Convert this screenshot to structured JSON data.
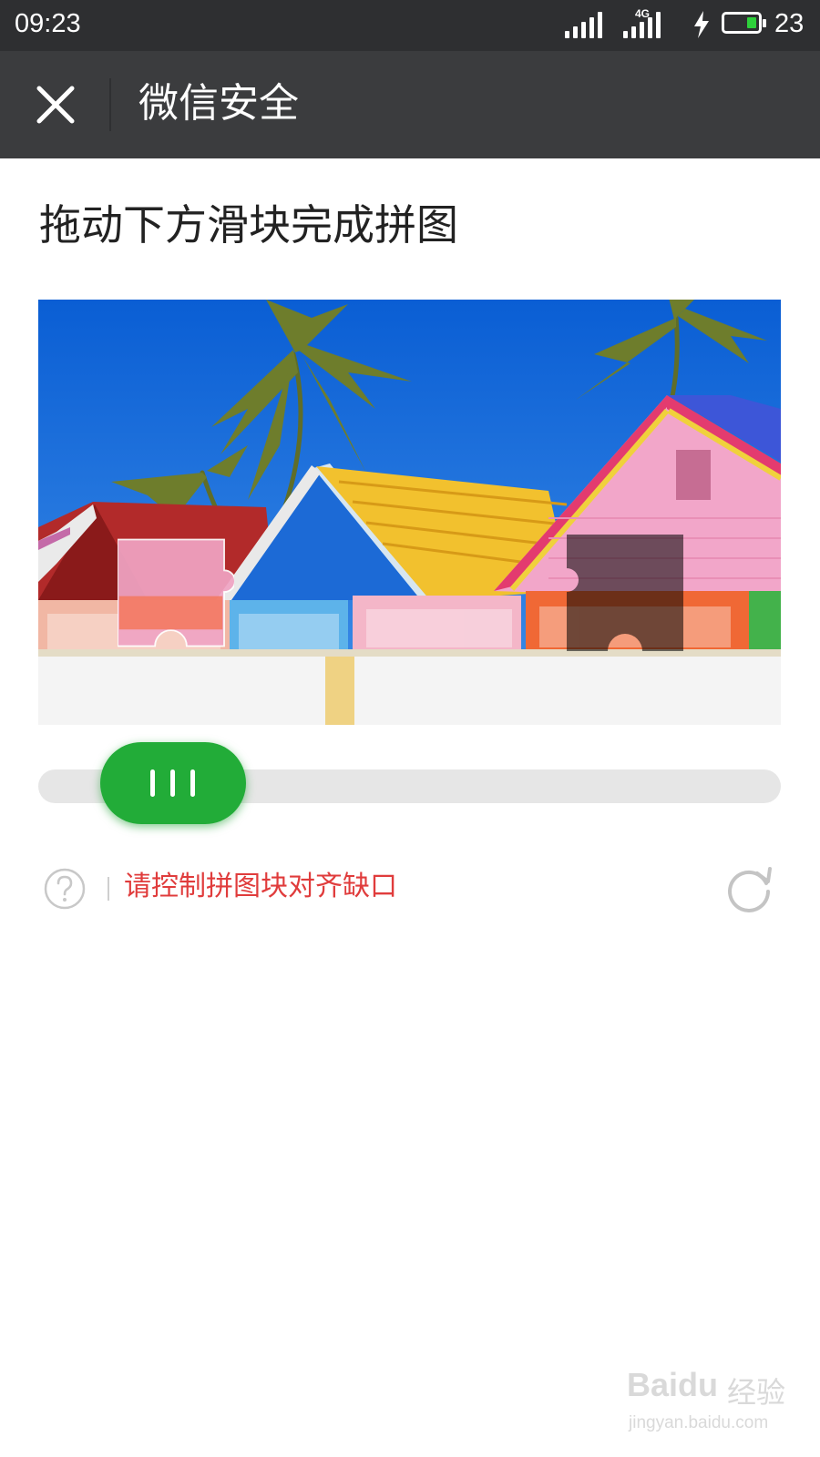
{
  "status_bar": {
    "time": "09:23",
    "network": "4G",
    "battery_level": "23",
    "icons": [
      "signal-icon",
      "signal-4g-icon",
      "charging-icon",
      "battery-icon"
    ]
  },
  "nav": {
    "title": "微信安全",
    "close_icon": "close-icon"
  },
  "page": {
    "title": "拖动下方滑块完成拼图"
  },
  "captcha": {
    "hint": "请控制拼图块对齐缺口",
    "help_icon": "question-icon",
    "refresh_icon": "refresh-icon",
    "slider_position": 0.09
  },
  "watermark": {
    "brand": "Baidu",
    "brand_cn": "经验",
    "url": "jingyan.baidu.com"
  },
  "colors": {
    "status_bar_bg": "#2e2f31",
    "nav_bg": "#3b3c3e",
    "accent_green": "#22ac38",
    "hint_red": "#e03c3c",
    "track": "#e6e6e6"
  }
}
